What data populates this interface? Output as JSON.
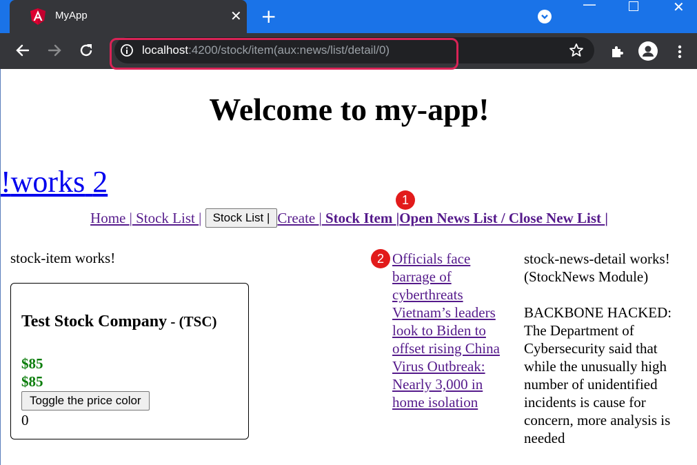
{
  "browser": {
    "tab_title": "MyApp",
    "tab_close": "✕",
    "new_tab": "+",
    "url_host": "localhost",
    "url_path": ":4200/stock/item(aux:news/list/detail/0)",
    "highlight_color": "#d92356",
    "accent_color": "#1a73e8"
  },
  "page": {
    "welcome": "Welcome to my-app!",
    "works_link": "2 works!"
  },
  "nav": {
    "home": "Home ",
    "sep1": "|",
    "stock_list": " Stock List ",
    "sep2": "|",
    "stock_list_button": "Stock List |",
    "create": "Create ",
    "sep3": "|",
    "stock_item": " Stock Item ",
    "sep4": "|",
    "open_news": "Open News List / Close New List ",
    "sep5": "|"
  },
  "badges": {
    "one": "1",
    "two": "2",
    "color": "#e21b1b"
  },
  "stock_item": {
    "works": "stock-item works!",
    "name": "Test Stock Company",
    "dash": " - ",
    "code": "(TSC)",
    "price_1": "$85",
    "price_2": "$85",
    "toggle_label": "Toggle the price color",
    "counter": "0",
    "price_color": "#0b7d0b"
  },
  "news_list": {
    "items": [
      "Officials face barrage of cyberthreats",
      "Vietnam’s leaders look to Biden to offset rising China",
      "Virus Outbreak: Nearly 3,000 in home isolation"
    ]
  },
  "news_detail": {
    "line1": "stock-news-detail works!",
    "line2": "(StockNews Module)",
    "body": "BACKBONE HACKED: The Department of Cybersecurity said that while the unusually high number of unidentified incidents is cause for concern, more analysis is needed"
  }
}
